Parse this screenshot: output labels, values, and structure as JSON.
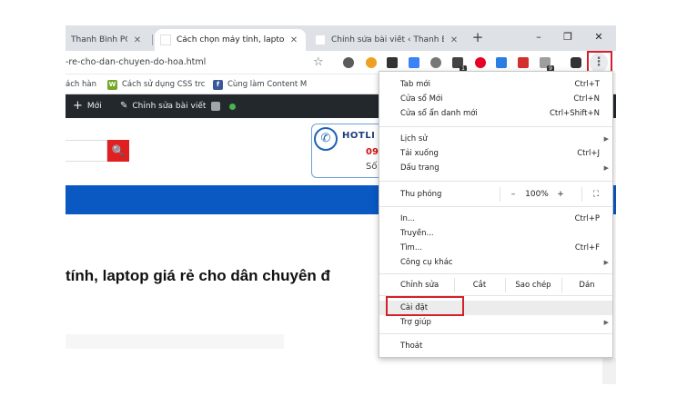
{
  "tabs": [
    {
      "label": "Thanh Bình PC —",
      "close": "✕"
    },
    {
      "label": "Cách chọn máy tính, laptop giá",
      "close": "✕"
    },
    {
      "label": "Chỉnh sửa bài viết ‹ Thanh Bình",
      "close": "✕"
    }
  ],
  "new_tab": "+",
  "window_controls": {
    "minimize": "–",
    "restore": "❐",
    "close": "✕"
  },
  "toolbar": {
    "url": "-re-cho-dan-chuyen-do-hoa.html",
    "star": "☆",
    "ext_badges": {
      "ext6": "1",
      "ext11": "9"
    },
    "menu_button": "⋮"
  },
  "bookmarks": [
    {
      "label": "ách hàn",
      "icon": ""
    },
    {
      "label": "Cách sử dụng CSS trc",
      "icon": "W"
    },
    {
      "label": "Cùng làm Content M",
      "icon": "f"
    }
  ],
  "adminbar": {
    "new_label": "Mới",
    "plus": "+",
    "edit_label": "Chỉnh sửa bài viết",
    "pencil": "✎"
  },
  "page": {
    "search_icon": "🔍",
    "hotline_label": "HOTLI",
    "hotline_number": "09",
    "hotline_sub": "Số",
    "headline": "tính, laptop giá rẻ cho dân chuyên đ"
  },
  "menu": {
    "new_tab": {
      "label": "Tab mới",
      "shortcut": "Ctrl+T"
    },
    "new_window": {
      "label": "Cửa sổ Mới",
      "shortcut": "Ctrl+N"
    },
    "incognito": {
      "label": "Cửa sổ ẩn danh mới",
      "shortcut": "Ctrl+Shift+N"
    },
    "history": {
      "label": "Lịch sử"
    },
    "downloads": {
      "label": "Tải xuống",
      "shortcut": "Ctrl+J"
    },
    "bookmarks": {
      "label": "Dấu trang"
    },
    "zoom": {
      "label": "Thu phóng",
      "minus": "–",
      "value": "100%",
      "plus": "+",
      "fullscreen": "⛶"
    },
    "print": {
      "label": "In...",
      "shortcut": "Ctrl+P"
    },
    "cast": {
      "label": "Truyền..."
    },
    "find": {
      "label": "Tìm...",
      "shortcut": "Ctrl+F"
    },
    "more_tools": {
      "label": "Công cụ khác"
    },
    "edit": {
      "label": "Chỉnh sửa",
      "cut": "Cắt",
      "copy": "Sao chép",
      "paste": "Dán"
    },
    "settings": {
      "label": "Cài đặt"
    },
    "help": {
      "label": "Trợ giúp"
    },
    "exit": {
      "label": "Thoát"
    },
    "arrow": "▶"
  },
  "colors": {
    "highlight_red": "#d3202a",
    "wp_admin_bar": "#23282d",
    "site_blue": "#0a58c2",
    "search_red": "#e02020"
  }
}
